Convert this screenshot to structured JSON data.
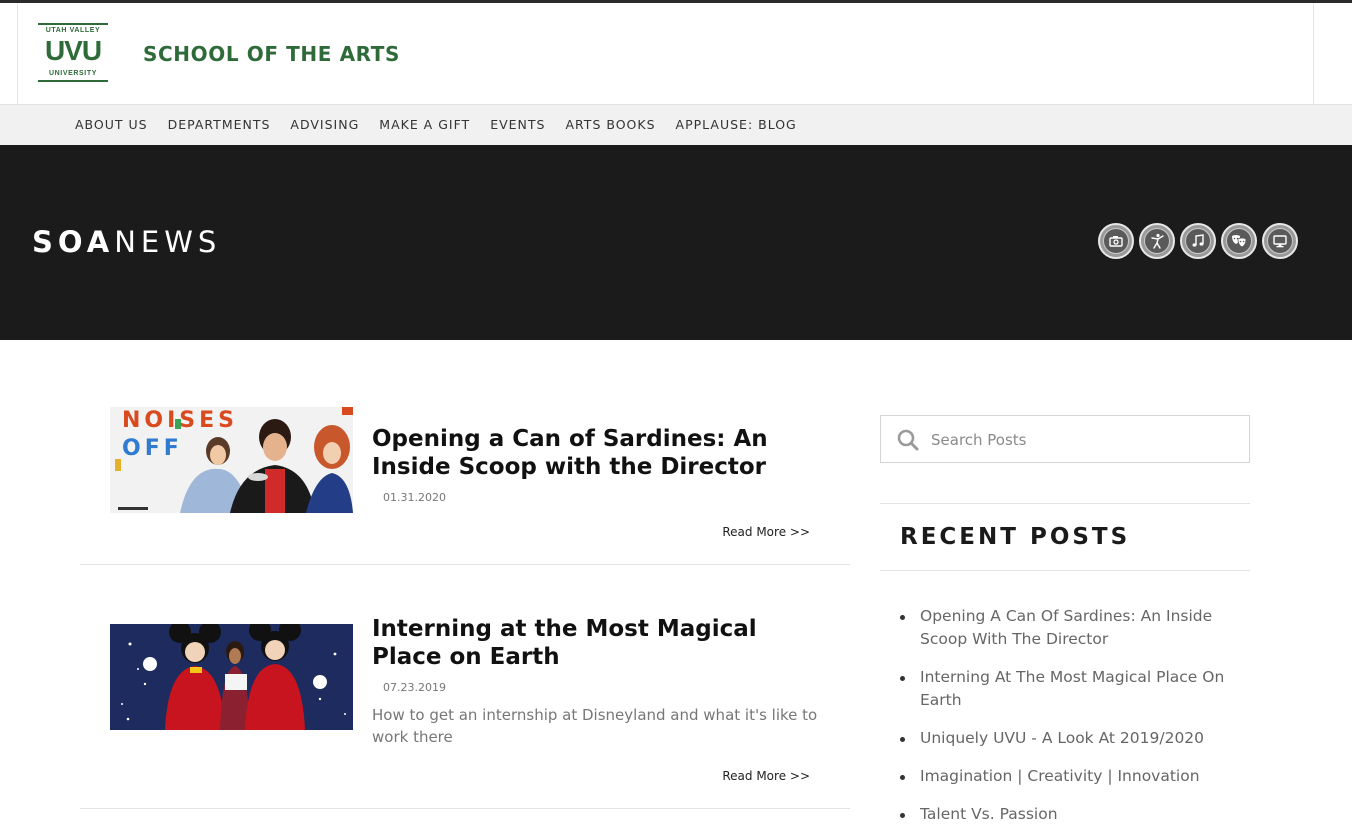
{
  "brand": {
    "logo_top": "UTAH VALLEY",
    "logo_main": "UVU",
    "logo_bottom": "UNIVERSITY",
    "site_title": "SCHOOL OF THE ARTS",
    "accent_color": "#2f6b39"
  },
  "nav": {
    "items": [
      {
        "label": "ABOUT US"
      },
      {
        "label": "DEPARTMENTS"
      },
      {
        "label": "ADVISING"
      },
      {
        "label": "MAKE A GIFT"
      },
      {
        "label": "EVENTS"
      },
      {
        "label": "ARTS BOOKS"
      },
      {
        "label": "APPLAUSE: BLOG"
      }
    ]
  },
  "hero": {
    "title_bold": "SOA",
    "title_light": "NEWS",
    "category_icons": [
      "camera-icon",
      "dancer-icon",
      "music-note-icon",
      "theater-masks-icon",
      "monitor-icon"
    ]
  },
  "posts": [
    {
      "title": "Opening a Can of Sardines: An Inside Scoop with the Director",
      "date": "01.31.2020",
      "excerpt": "",
      "read_more": "Read More >>",
      "thumb_text": "NOISES OFF"
    },
    {
      "title": "Interning at the Most Magical Place on Earth",
      "date": "07.23.2019",
      "excerpt": "How to get an internship at Disneyland and what it's like to work there",
      "read_more": "Read More >>"
    }
  ],
  "sidebar": {
    "search_placeholder": "Search Posts",
    "recent_title": "RECENT POSTS",
    "recent_posts": [
      "Opening A Can Of Sardines: An Inside Scoop With The Director",
      "Interning At The Most Magical Place On Earth",
      "Uniquely UVU - A Look At 2019/2020",
      "Imagination | Creativity | Innovation",
      "Talent Vs. Passion"
    ]
  }
}
